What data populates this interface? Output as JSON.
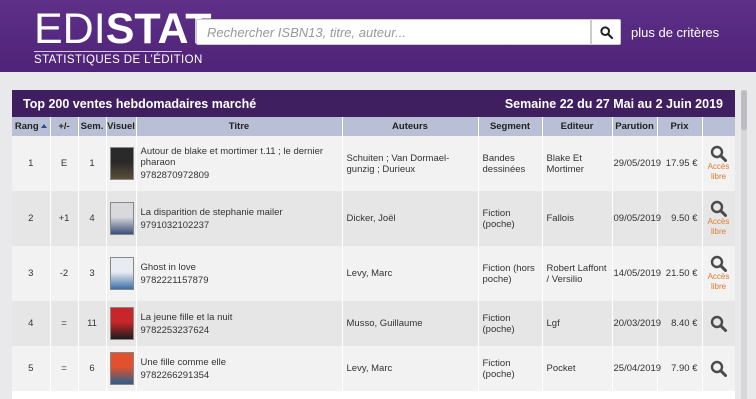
{
  "brand": {
    "logo_light": "EDI",
    "logo_bold": "STAT",
    "tagline": "STATISTIQUES DE L’ÉDITION"
  },
  "search": {
    "placeholder": "Rechercher ISBN13, titre, auteur...",
    "more_criteria": "plus de critères",
    "icon": "search-icon"
  },
  "panel": {
    "title": "Top 200 ventes hebdomadaires marché",
    "period": "Semaine 22 du 27 Mai au 2 Juin 2019"
  },
  "table": {
    "columns": {
      "rang": "Rang",
      "delta": "+/-",
      "sem": "Sem.",
      "visuel": "Visuel",
      "titre": "Titre",
      "auteurs": "Auteurs",
      "segment": "Segment",
      "editeur": "Editeur",
      "parution": "Parution",
      "prix": "Prix"
    },
    "free_label": "Accès libre",
    "rows": [
      {
        "rank": "1",
        "delta": "E",
        "weeks": "1",
        "title": "Autour de blake et mortimer t.11 ; le dernier pharaon",
        "isbn": "9782870972809",
        "authors": "Schuiten ; Van Dormael-gunzig ; Durieux",
        "segment": "Bandes dessinées",
        "publisher": "Blake Et Mortimer",
        "date": "29/05/2019",
        "price": "17.95 €",
        "free": true,
        "cover_colors": [
          "#2b2a2a",
          "#5a4e38"
        ]
      },
      {
        "rank": "2",
        "delta": "+1",
        "weeks": "4",
        "title": "La disparition de stephanie mailer",
        "isbn": "9791032102237",
        "authors": "Dicker, Joël",
        "segment": "Fiction (poche)",
        "publisher": "Fallois",
        "date": "09/05/2019",
        "price": "9.50 €",
        "free": true,
        "cover_colors": [
          "#d9d9dd",
          "#3a4f7a"
        ]
      },
      {
        "rank": "3",
        "delta": "-2",
        "weeks": "3",
        "title": "Ghost in love",
        "isbn": "9782221157879",
        "authors": "Levy, Marc",
        "segment": "Fiction (hors poche)",
        "publisher": "Robert Laffont / Versilio",
        "date": "14/05/2019",
        "price": "21.50 €",
        "free": true,
        "cover_colors": [
          "#e8ecf2",
          "#3c6fa8"
        ]
      },
      {
        "rank": "4",
        "delta": "=",
        "weeks": "11",
        "title": "La jeune fille et la nuit",
        "isbn": "9782253237624",
        "authors": "Musso, Guillaume",
        "segment": "Fiction (poche)",
        "publisher": "Lgf",
        "date": "20/03/2019",
        "price": "8.40 €",
        "free": false,
        "cover_colors": [
          "#c8262b",
          "#1d1d1d"
        ]
      },
      {
        "rank": "5",
        "delta": "=",
        "weeks": "6",
        "title": "Une fille comme elle",
        "isbn": "9782266291354",
        "authors": "Levy, Marc",
        "segment": "Fiction (poche)",
        "publisher": "Pocket",
        "date": "25/04/2019",
        "price": "7.90 €",
        "free": false,
        "cover_colors": [
          "#e2512e",
          "#2c5e8c"
        ]
      }
    ]
  }
}
